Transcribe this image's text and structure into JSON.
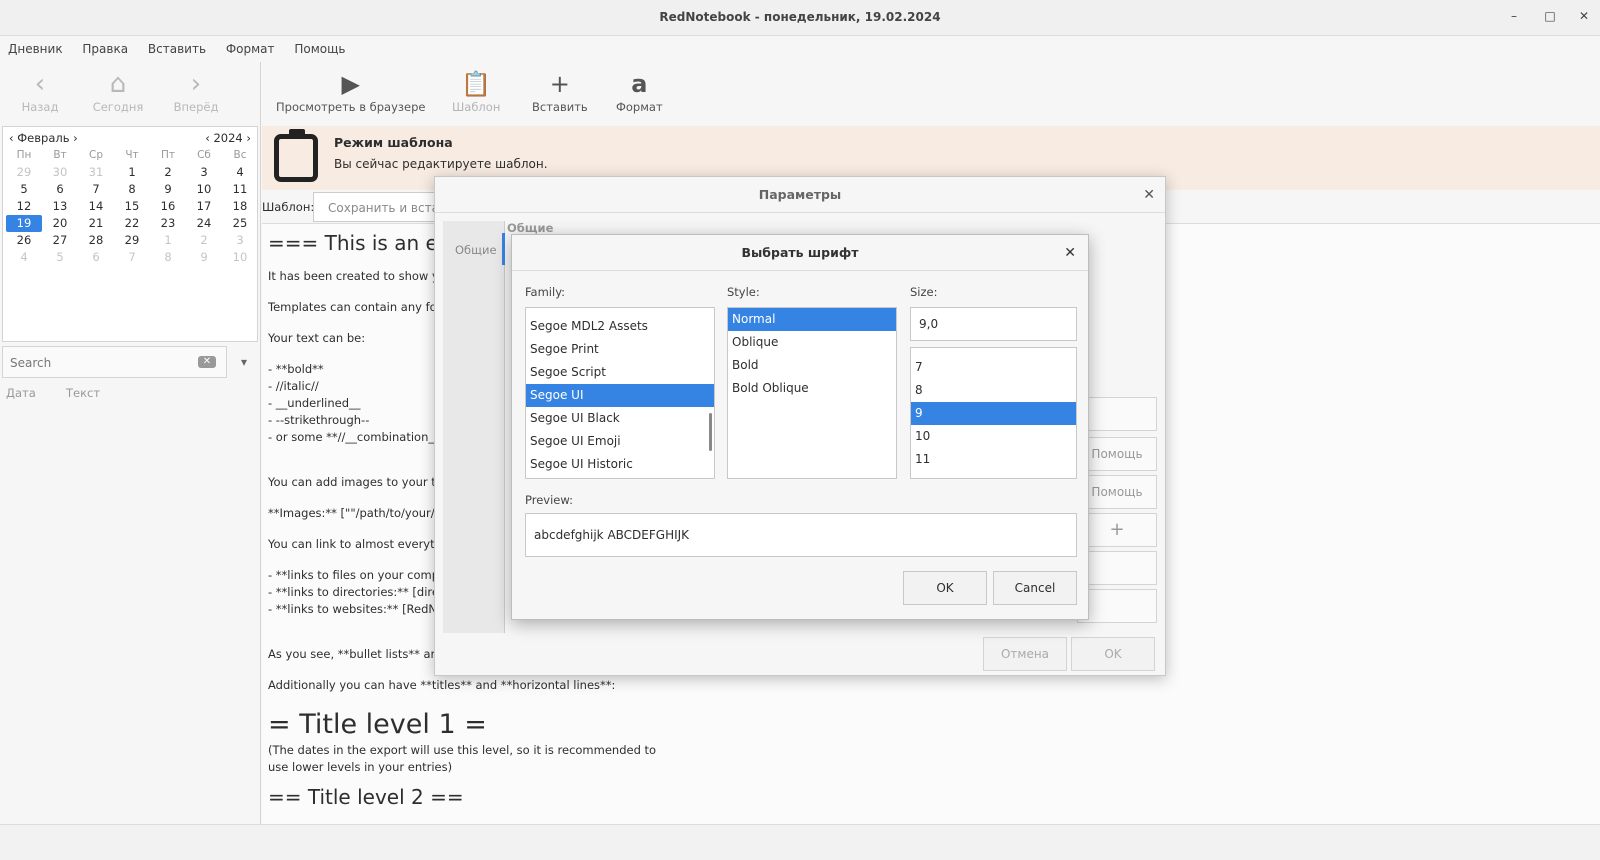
{
  "window": {
    "title": "RedNotebook - понедельник, 19.02.2024"
  },
  "menu": [
    "Дневник",
    "Правка",
    "Вставить",
    "Формат",
    "Помощь"
  ],
  "nav": {
    "back": "Назад",
    "today": "Сегодня",
    "forward": "Вперёд"
  },
  "calendar": {
    "month": "Февраль",
    "year": "2024",
    "day_names": [
      "Пн",
      "Вт",
      "Ср",
      "Чт",
      "Пт",
      "Сб",
      "Вс"
    ],
    "weeks": [
      [
        "29",
        "30",
        "31",
        "1",
        "2",
        "3",
        "4"
      ],
      [
        "5",
        "6",
        "7",
        "8",
        "9",
        "10",
        "11"
      ],
      [
        "12",
        "13",
        "14",
        "15",
        "16",
        "17",
        "18"
      ],
      [
        "19",
        "20",
        "21",
        "22",
        "23",
        "24",
        "25"
      ],
      [
        "26",
        "27",
        "28",
        "29",
        "1",
        "2",
        "3"
      ],
      [
        "4",
        "5",
        "6",
        "7",
        "8",
        "9",
        "10"
      ]
    ],
    "selected": "19"
  },
  "search": {
    "placeholder": "Search",
    "col_date": "Дата",
    "col_text": "Текст"
  },
  "toolbar": {
    "preview": "Просмотреть в браузере",
    "template": "Шаблон",
    "insert": "Вставить",
    "format": "Формат"
  },
  "banner": {
    "title": "Режим шаблона",
    "subtitle": "Вы сейчас редактируете шаблон."
  },
  "template_bar": {
    "label": "Шаблон:",
    "button": "Сохранить и вставить"
  },
  "editor": {
    "h1": "=== This is an exa",
    "lines": [
      "It has been created to show you",
      "Templates can contain any form",
      "Your text can be:",
      "- **bold**",
      "- //italic//",
      "- __underlined__",
      "- --strikethrough--",
      "- or some **//__combination__/",
      "You can add images to your tem",
      "**Images:** [\"\"/path/to/your/pi",
      "You can link to almost everythin",
      "- **links to files on your compu",
      "- **links to directories:** [direct",
      "- **links to websites:** [RedNot",
      "As you see, **bullet lists** are al",
      "Additionally you can have **titles** and **horizontal lines**:"
    ],
    "title1": "= Title level 1 =",
    "note": "(The dates in the export will use this level, so it is recommended to use lower levels in your entries)",
    "title2": "== Title level 2 =="
  },
  "params_dialog": {
    "title": "Параметры",
    "sidebar_item": "Общие",
    "group": "Общие",
    "help1": "Помощь",
    "help2": "Помощь",
    "cancel": "Отмена",
    "ok": "OK"
  },
  "font_dialog": {
    "title": "Выбрать шрифт",
    "family_label": "Family:",
    "style_label": "Style:",
    "size_label": "Size:",
    "families": [
      "Segoe MDL2 Assets",
      "Segoe Print",
      "Segoe Script",
      "Segoe UI",
      "Segoe UI Black",
      "Segoe UI Emoji",
      "Segoe UI Historic"
    ],
    "selected_family": "Segoe UI",
    "styles": [
      "Normal",
      "Oblique",
      "Bold",
      "Bold Oblique"
    ],
    "selected_style": "Normal",
    "size_value": "9,0",
    "sizes": [
      "7",
      "8",
      "9",
      "10",
      "11"
    ],
    "selected_size": "9",
    "preview_label": "Preview:",
    "preview_text": "abcdefghijk ABCDEFGHIJK",
    "ok": "OK",
    "cancel": "Cancel"
  }
}
